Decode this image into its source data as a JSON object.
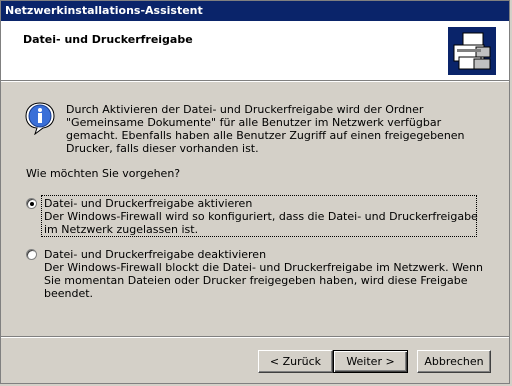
{
  "window": {
    "title": "Netzwerkinstallations-Assistent"
  },
  "header": {
    "title": "Datei- und Druckerfreigabe",
    "icon": "network-printer-icon"
  },
  "info": {
    "icon": "info-icon",
    "text": "Durch Aktivieren der Datei- und Druckerfreigabe wird der Ordner \"Gemeinsame Dokumente\" für alle Benutzer im Netzwerk verfügbar gemacht. Ebenfalls haben alle Benutzer Zugriff auf einen freigegebenen Drucker, falls dieser vorhanden ist."
  },
  "question": "Wie möchten Sie vorgehen?",
  "options": [
    {
      "label": "Datei- und Druckerfreigabe aktivieren",
      "description": "Der Windows-Firewall wird so konfiguriert, dass die Datei- und Druckerfreigabe im Netzwerk zugelassen ist.",
      "selected": true
    },
    {
      "label": "Datei- und Druckerfreigabe deaktivieren",
      "description": "Der Windows-Firewall blockt die Datei- und Druckerfreigabe im Netzwerk. Wenn Sie momentan Dateien oder Drucker freigegeben haben, wird diese Freigabe beendet.",
      "selected": false
    }
  ],
  "buttons": {
    "back": "< Zurück",
    "next": "Weiter >",
    "cancel": "Abbrechen"
  }
}
